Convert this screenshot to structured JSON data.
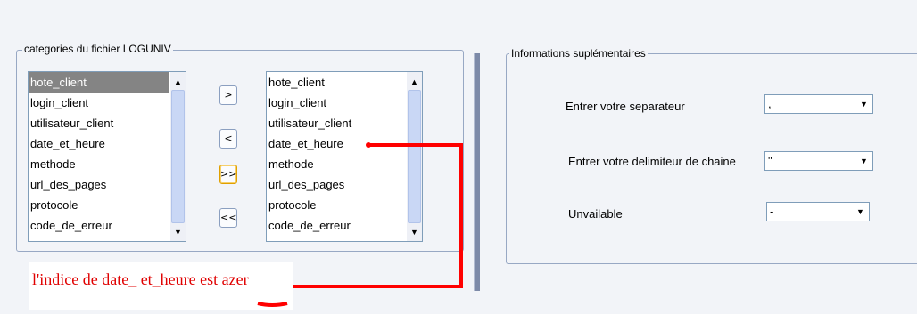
{
  "left_group": {
    "title": "categories du fichier LOGUNIV",
    "available_list": {
      "items": [
        "hote_client",
        "login_client",
        "utilisateur_client",
        "date_et_heure",
        "methode",
        "url_des_pages",
        "protocole",
        "code_de_erreur"
      ],
      "selected_index": 0
    },
    "buttons": {
      "move_right": ">",
      "move_left": "<",
      "move_all_right": ">>",
      "move_all_left": "<<"
    },
    "chosen_list": {
      "items": [
        "hote_client",
        "login_client",
        "utilisateur_client",
        "date_et_heure",
        "methode",
        "url_des_pages",
        "protocole",
        "code_de_erreur"
      ]
    }
  },
  "right_group": {
    "title": "Informations suplémentaires",
    "fields": [
      {
        "label": "Entrer votre separateur",
        "value": ","
      },
      {
        "label": "Entrer votre delimiteur de chaine",
        "value": "\""
      },
      {
        "label": "Unvailable",
        "value": "-"
      }
    ]
  },
  "annotation": {
    "text": "l'indice de date_ et_heure est ",
    "highlight": "azer",
    "color": "#e00000"
  },
  "icons": {
    "scroll_up": "scroll-up-arrow-icon",
    "scroll_down": "scroll-down-arrow-icon",
    "combo_dropdown": "chevron-down-icon"
  }
}
